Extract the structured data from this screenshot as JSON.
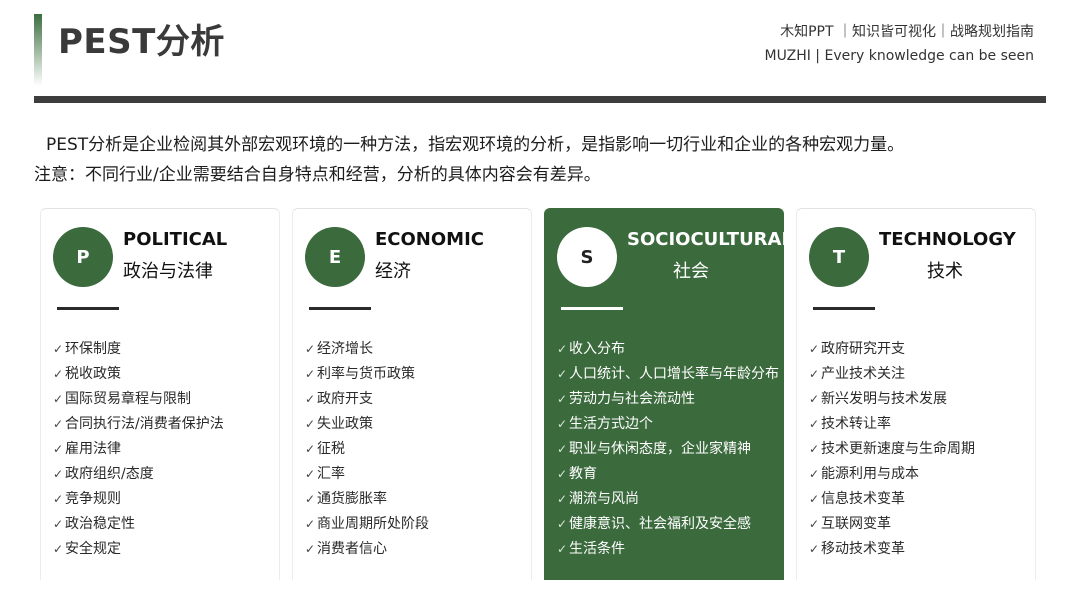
{
  "header": {
    "title": "PEST分析",
    "brand_line1": "木知PPT ｜知识皆可视化｜战略规划指南",
    "brand_line2": "MUZHI | Every knowledge can be seen"
  },
  "intro": {
    "line1": "PEST分析是企业检阅其外部宏观环境的一种方法，指宏观环境的分析，是指影响一切行业和企业的各种宏观力量。",
    "line2": "注意：不同行业/企业需要结合自身特点和经营，分析的具体内容会有差异。"
  },
  "check_mark": "✓",
  "colors": {
    "accent": "#3b6a3d",
    "rule": "#3d3d3d"
  },
  "cards": [
    {
      "letter": "P",
      "en": "POLITICAL",
      "zh": "政治与法律",
      "items": [
        "环保制度",
        "税收政策",
        "国际贸易章程与限制",
        "合同执行法/消费者保护法",
        "雇用法律",
        "政府组织/态度",
        "竞争规则",
        "政治稳定性",
        "安全规定"
      ]
    },
    {
      "letter": "E",
      "en": "ECONOMIC",
      "zh": "经济",
      "items": [
        "经济增长",
        "利率与货币政策",
        "政府开支",
        "失业政策",
        "征税",
        "汇率",
        "通货膨胀率",
        "商业周期所处阶段",
        "消费者信心"
      ]
    },
    {
      "letter": "S",
      "en": "SOCIOCULTURAL",
      "zh": "社会",
      "items": [
        "收入分布",
        "人口统计、人口增长率与年龄分布",
        "劳动力与社会流动性",
        "生活方式边个",
        "职业与休闲态度，企业家精神",
        "教育",
        "潮流与风尚",
        "健康意识、社会福利及安全感",
        "生活条件"
      ]
    },
    {
      "letter": "T",
      "en": "TECHNOLOGY",
      "zh": "技术",
      "items": [
        "政府研究开支",
        "产业技术关注",
        "新兴发明与技术发展",
        "技术转让率",
        "技术更新速度与生命周期",
        "能源利用与成本",
        "信息技术变革",
        "互联网变革",
        "移动技术变革"
      ]
    }
  ]
}
